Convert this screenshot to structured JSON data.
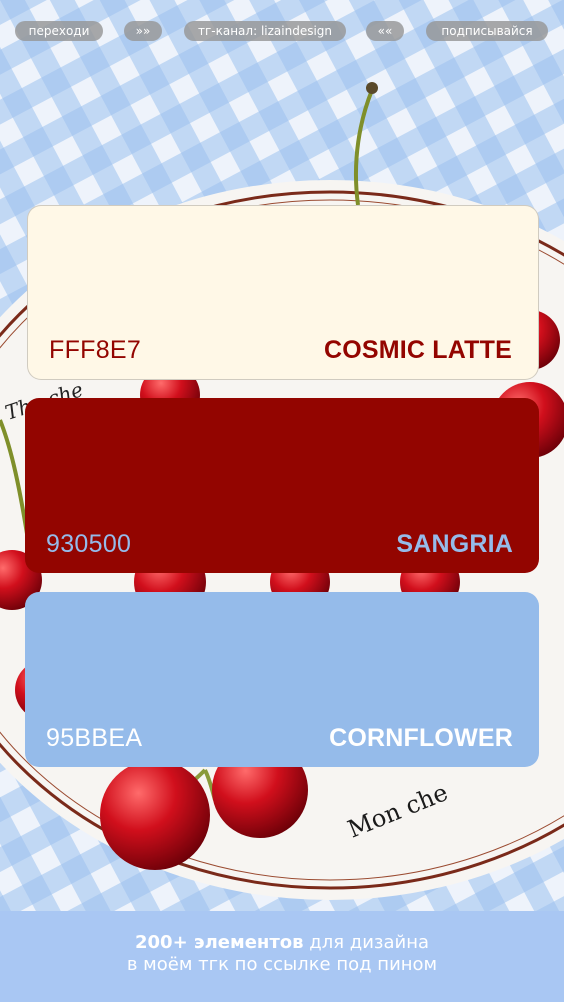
{
  "top_pills": [
    {
      "label": "переходи"
    },
    {
      "label": "»»"
    },
    {
      "label": "тг-канал: lizaindesign"
    },
    {
      "label": "««"
    },
    {
      "label": "подписывайся"
    }
  ],
  "swatches": [
    {
      "hex": "FFF8E7",
      "name": "COSMIC LATTE",
      "color": "#FFF8E7",
      "text_color": "#930500"
    },
    {
      "hex": "930500",
      "name": "SANGRIA",
      "color": "#930500",
      "text_color": "#95BBEA"
    },
    {
      "hex": "95BBEA",
      "name": "CORNFLOWER",
      "color": "#95BBEA",
      "text_color": "#FFFFFF"
    }
  ],
  "banner": {
    "bold": "200+ элементов",
    "line1_rest": " для дизайна",
    "line2": "в моём тгк по ссылке под пином",
    "color": "#A9C7F3"
  },
  "background": {
    "plate_text_top": "The che",
    "plate_text_bottom": "Mon che"
  }
}
